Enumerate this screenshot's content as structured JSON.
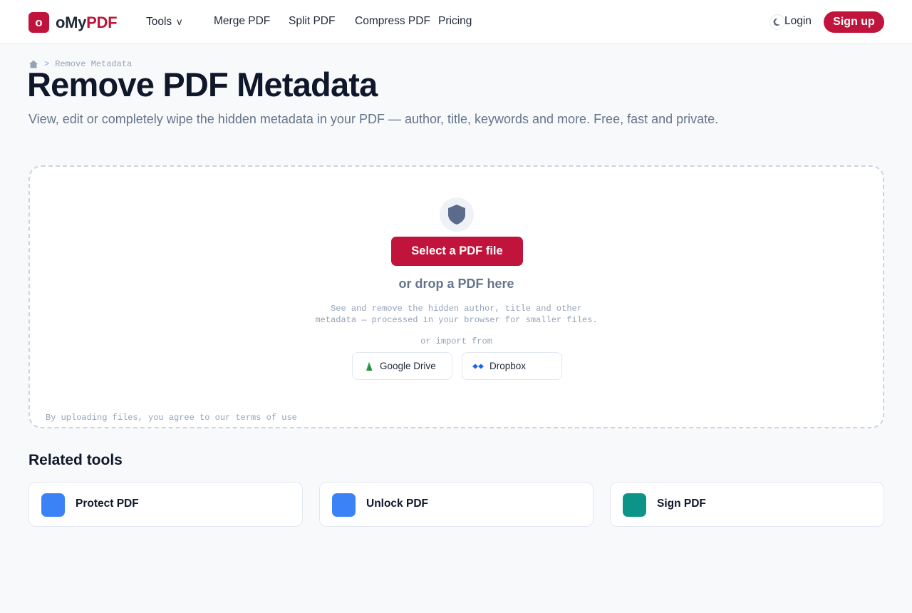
{
  "header": {
    "logo_mark": "o",
    "logo_text_a": "oMy",
    "logo_text_b": "PDF",
    "nav": {
      "tools": "Tools",
      "tools_chevron": "v",
      "merge": "Merge PDF",
      "split": "Split PDF",
      "compress": "Compress PDF",
      "pricing": "Pricing"
    },
    "login": "Login",
    "signup": "Sign up",
    "theme_icon": "moon-icon"
  },
  "breadcrumb": {
    "separator": ">",
    "current": "Remove Metadata"
  },
  "page": {
    "title": "Remove PDF Metadata",
    "subtitle": "View, edit or completely wipe the hidden metadata in your PDF — author, title, keywords and more. Free, fast and private."
  },
  "dropzone": {
    "icon": "shield-icon",
    "select_button": "Select a PDF file",
    "drop_text": "or drop a PDF here",
    "description": "See and remove the hidden author, title and other metadata — processed in your browser for smaller files.",
    "import_label": "or import from",
    "google_drive": "Google Drive",
    "dropbox": "Dropbox",
    "terms": "By uploading files, you agree to our terms of use"
  },
  "related": {
    "title": "Related tools",
    "items": [
      {
        "label": "Protect PDF",
        "color": "#3b82f6"
      },
      {
        "label": "Unlock PDF",
        "color": "#3b82f6"
      },
      {
        "label": "Sign PDF",
        "color": "#0d9488"
      }
    ]
  },
  "colors": {
    "brand": "#c0143c",
    "text_dark": "#0f172a",
    "muted": "#64748b"
  }
}
